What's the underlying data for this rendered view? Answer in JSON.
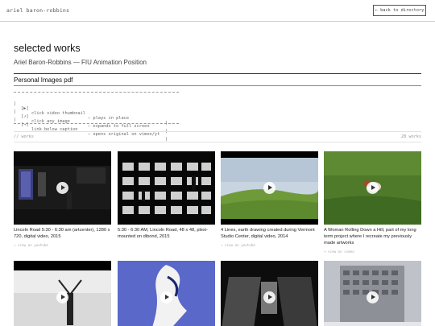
{
  "header": {
    "site_name": "ariel baron-robbins",
    "back_label": "← back to directory"
  },
  "page": {
    "title": "selected works",
    "subtitle": "Ariel Baron-Robbins — FIU Animation Position",
    "pdf_link": "Personal Images pdf"
  },
  "help": {
    "lines": [
      {
        "icon": "[▶]",
        "action": "click video thumbnail",
        "result": "— plays in place"
      },
      {
        "icon": "[↗]",
        "action": "click any image",
        "result": "— expands to full screen"
      },
      {
        "icon": "[→]",
        "action": "link below caption",
        "result": "— opens original on vimeo/yt"
      }
    ]
  },
  "works": {
    "left_label": "// works",
    "count_label": "28 works",
    "items": [
      {
        "caption": "Lincoln Road 5:30 - 6:30 am (artcenter), 1280 x 720, digital video, 2015",
        "meta": "→ view on youtube"
      },
      {
        "caption": "5:30 - 6:30 AM, Lincoln Road, 48 x 48, plexi-mounted on dibond, 2015",
        "meta": ""
      },
      {
        "caption": "4 Lines, earth drawing created during Vermont Studio Center, digital video, 2014",
        "meta": "→ view on youtube"
      },
      {
        "caption": "A Woman Rolling Down a Hill, part of my long term project where I recreate my previously made artworks",
        "meta": "→ view on vimeo"
      },
      {
        "caption": "",
        "meta": ""
      },
      {
        "caption": "",
        "meta": ""
      },
      {
        "caption": "",
        "meta": ""
      },
      {
        "caption": "",
        "meta": ""
      }
    ]
  }
}
